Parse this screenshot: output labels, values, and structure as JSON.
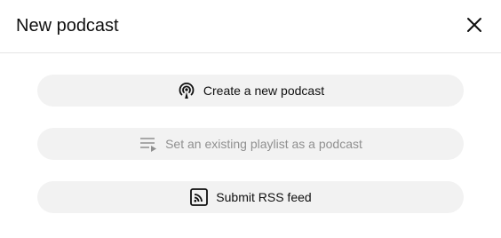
{
  "dialog": {
    "title": "New podcast",
    "close_icon": "close-icon"
  },
  "options": [
    {
      "label": "Create a new podcast",
      "icon": "podcast-icon",
      "enabled": true
    },
    {
      "label": "Set an existing playlist as a podcast",
      "icon": "playlist-add-icon",
      "enabled": false
    },
    {
      "label": "Submit RSS feed",
      "icon": "rss-feed-icon",
      "enabled": true
    }
  ],
  "colors": {
    "button_background": "#f2f2f2",
    "text": "#0f0f0f",
    "disabled_text": "#909090",
    "divider": "#e5e5e5"
  }
}
